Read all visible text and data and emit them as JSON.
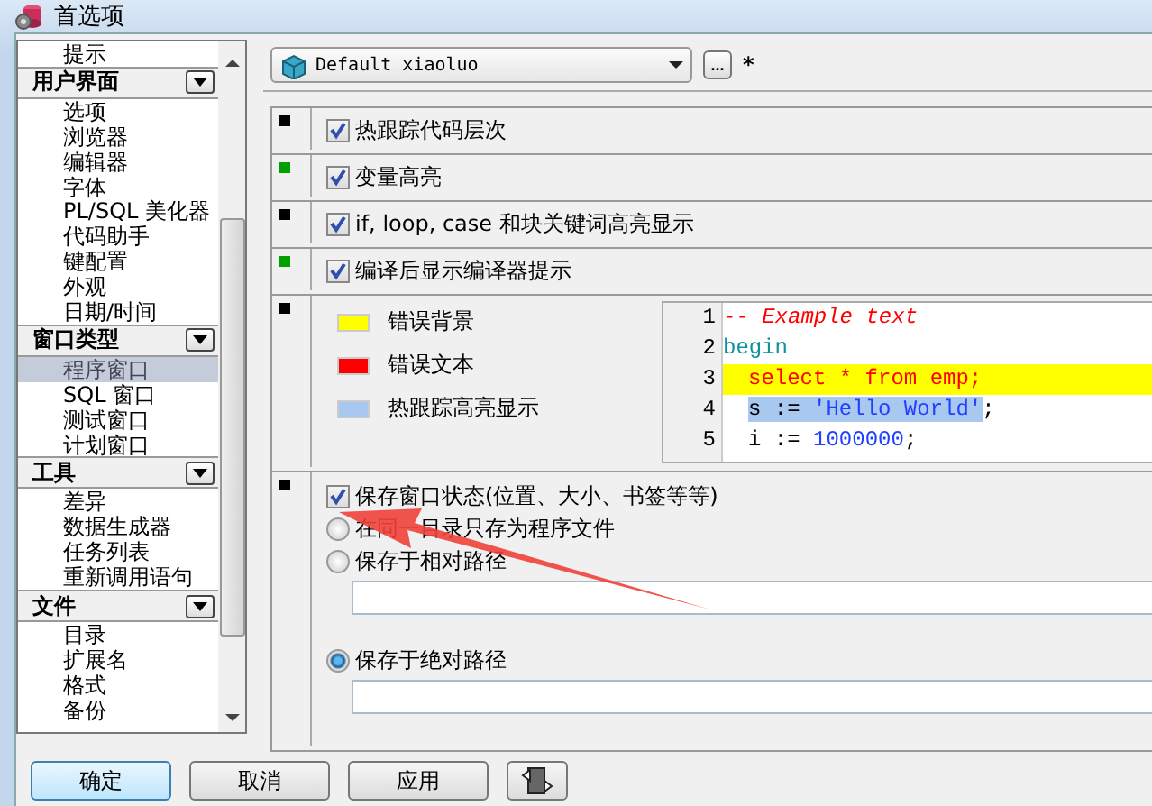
{
  "window": {
    "title": "首选项"
  },
  "sidebar": {
    "groups": [
      {
        "items": [
          {
            "label": "提示",
            "selected": false
          }
        ]
      },
      {
        "title": "用户界面",
        "items": [
          {
            "label": "选项",
            "selected": false
          },
          {
            "label": "浏览器",
            "selected": false
          },
          {
            "label": "编辑器",
            "selected": false
          },
          {
            "label": "字体",
            "selected": false
          },
          {
            "label": "PL/SQL 美化器",
            "selected": false
          },
          {
            "label": "代码助手",
            "selected": false
          },
          {
            "label": "键配置",
            "selected": false
          },
          {
            "label": "外观",
            "selected": false
          },
          {
            "label": "日期/时间",
            "selected": false
          }
        ]
      },
      {
        "title": "窗口类型",
        "items": [
          {
            "label": "程序窗口",
            "selected": true
          },
          {
            "label": "SQL 窗口",
            "selected": false
          },
          {
            "label": "测试窗口",
            "selected": false
          },
          {
            "label": "计划窗口",
            "selected": false
          }
        ]
      },
      {
        "title": "工具",
        "items": [
          {
            "label": "差异",
            "selected": false
          },
          {
            "label": "数据生成器",
            "selected": false
          },
          {
            "label": "任务列表",
            "selected": false
          },
          {
            "label": "重新调用语句",
            "selected": false
          }
        ]
      },
      {
        "title": "文件",
        "items": [
          {
            "label": "目录",
            "selected": false
          },
          {
            "label": "扩展名",
            "selected": false
          },
          {
            "label": "格式",
            "selected": false
          },
          {
            "label": "备份",
            "selected": false
          }
        ]
      }
    ]
  },
  "profile": {
    "value": "Default xiaoluo",
    "more_button": "...",
    "modified_mark": "*"
  },
  "sections": [
    {
      "kind": "checkbox",
      "color": "#000000",
      "label": "热跟踪代码层次",
      "checked": true
    },
    {
      "kind": "checkbox",
      "color": "#00a000",
      "label": "变量高亮",
      "checked": true
    },
    {
      "kind": "checkbox",
      "color": "#000000",
      "label": "if, loop, case 和块关键词高亮显示",
      "checked": true
    },
    {
      "kind": "checkbox",
      "color": "#00a000",
      "label": "编译后显示编译器提示",
      "checked": true
    },
    {
      "kind": "colors",
      "color": "#000000",
      "legend": [
        {
          "label": "错误背景",
          "color": "#ffff00"
        },
        {
          "label": "错误文本",
          "color": "#ff0000"
        },
        {
          "label": "热跟踪高亮显示",
          "color": "#a8c8f0"
        }
      ],
      "code": [
        {
          "number": "1",
          "error": false,
          "indented": false,
          "segments": [
            {
              "text": "-- Example text",
              "kind": "comment",
              "hot": false
            }
          ]
        },
        {
          "number": "2",
          "error": false,
          "indented": false,
          "segments": [
            {
              "text": "begin",
              "kind": "keyword",
              "hot": false
            }
          ]
        },
        {
          "number": "3",
          "error": true,
          "indented": true,
          "segments": [
            {
              "text": "select * from emp;",
              "kind": "error",
              "hot": false
            }
          ]
        },
        {
          "number": "4",
          "error": false,
          "indented": true,
          "segments": [
            {
              "text": "s := ",
              "kind": "plain",
              "hot": true
            },
            {
              "text": "'Hello World'",
              "kind": "string",
              "hot": true
            },
            {
              "text": ";",
              "kind": "plain",
              "hot": false
            }
          ]
        },
        {
          "number": "5",
          "error": false,
          "indented": true,
          "segments": [
            {
              "text": "i := ",
              "kind": "plain",
              "hot": false
            },
            {
              "text": "1000000",
              "kind": "number",
              "hot": false
            },
            {
              "text": ";",
              "kind": "plain",
              "hot": false
            }
          ]
        }
      ]
    },
    {
      "kind": "save",
      "color": "#000000",
      "label": "保存窗口状态(位置、大小、书签等等)",
      "checked": true,
      "options": [
        {
          "label": "在同一目录只存为程序文件",
          "selected": false,
          "field": false
        },
        {
          "label": "保存于相对路径",
          "selected": false,
          "field": true
        },
        {
          "label": "保存于绝对路径",
          "selected": true,
          "field": true
        }
      ]
    }
  ],
  "buttons": [
    {
      "kind": "text",
      "label": "确定",
      "default": true
    },
    {
      "kind": "text",
      "label": "取消",
      "default": false
    },
    {
      "kind": "text",
      "label": "应用",
      "default": false
    },
    {
      "kind": "icon",
      "default": false
    }
  ]
}
